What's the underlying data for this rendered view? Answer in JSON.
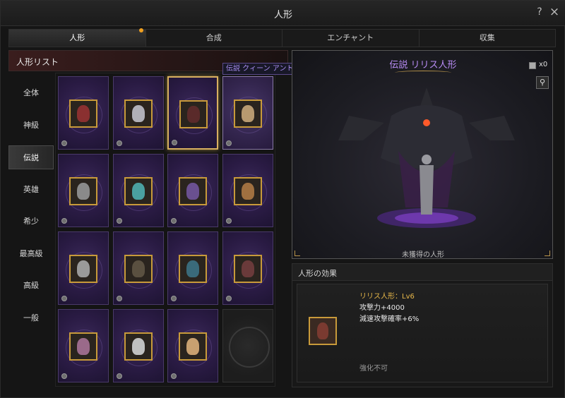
{
  "window": {
    "title": "人形",
    "help_icon": "?",
    "close_icon": "×"
  },
  "tabs": [
    {
      "label": "人形",
      "active": true,
      "notify": true
    },
    {
      "label": "合成"
    },
    {
      "label": "エンチャント"
    },
    {
      "label": "収集"
    }
  ],
  "list_header": "人形リスト",
  "side_items": [
    "全体",
    "神級",
    "伝説",
    "英雄",
    "希少",
    "最高級",
    "高級",
    "一般"
  ],
  "tooltip": "伝説 クィーン アント人形",
  "preview": {
    "title": "伝説 リリス人形",
    "count": "x0",
    "search_icon": "magnifier-icon",
    "status": "未獲得の人形"
  },
  "effects": {
    "title": "人形の効果",
    "name": "リリス人形：Lv6",
    "lines": [
      "攻撃力+4000",
      "減速攻撃確率+6%"
    ],
    "note": "強化不可"
  },
  "colors": {
    "accent_gold": "#c89a3a",
    "legend_purple": "#b88cf5",
    "card_purple": "#2a1b44",
    "notify_dot": "#f0a020"
  }
}
